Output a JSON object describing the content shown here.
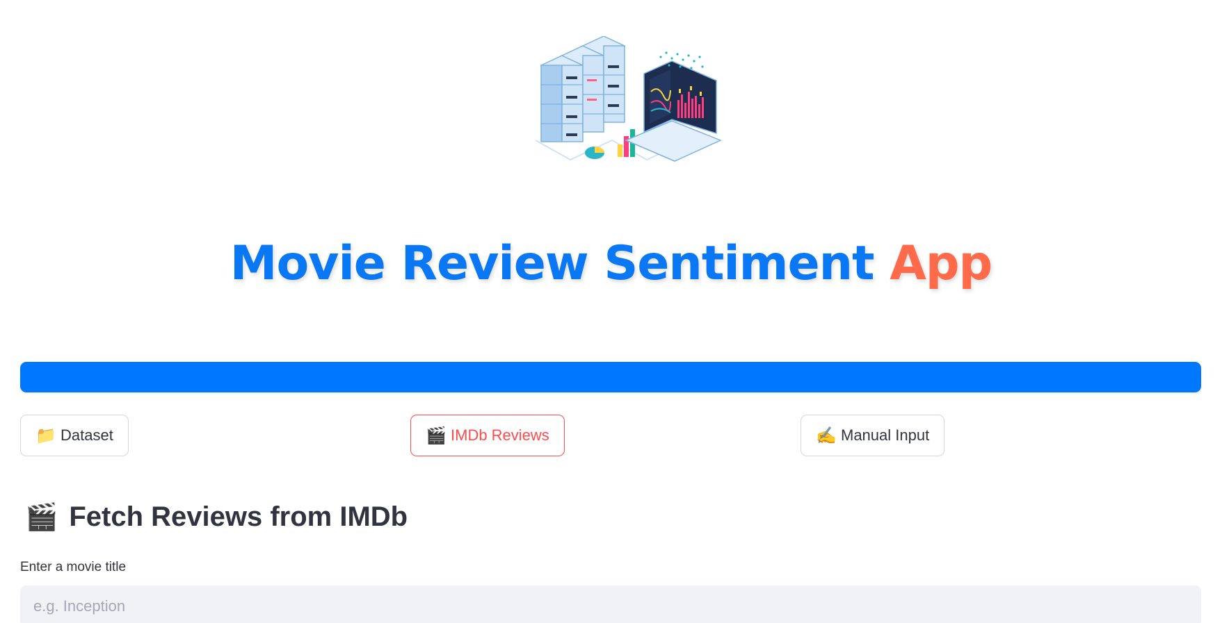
{
  "header": {
    "title_main": "Movie Review Sentiment ",
    "title_accent": "App"
  },
  "tabs": [
    {
      "icon": "folder-icon",
      "emoji": "📁",
      "label": "Dataset",
      "active": false
    },
    {
      "icon": "clapper-icon",
      "emoji": "🎬",
      "label": "IMDb Reviews",
      "active": true
    },
    {
      "icon": "writing-hand-icon",
      "emoji": "✍️",
      "label": "Manual Input",
      "active": false
    }
  ],
  "section": {
    "icon": "clapper-icon",
    "emoji": "🎬",
    "title": "Fetch Reviews from IMDb"
  },
  "movie_input": {
    "label": "Enter a movie title",
    "placeholder": "e.g. Inception",
    "value": ""
  },
  "colors": {
    "title_blue": "#0a78f5",
    "title_orange": "#ff6b4a",
    "banner": "#0077ff",
    "active_tab": "#ff4b4b",
    "input_bg": "#f0f2f6"
  }
}
